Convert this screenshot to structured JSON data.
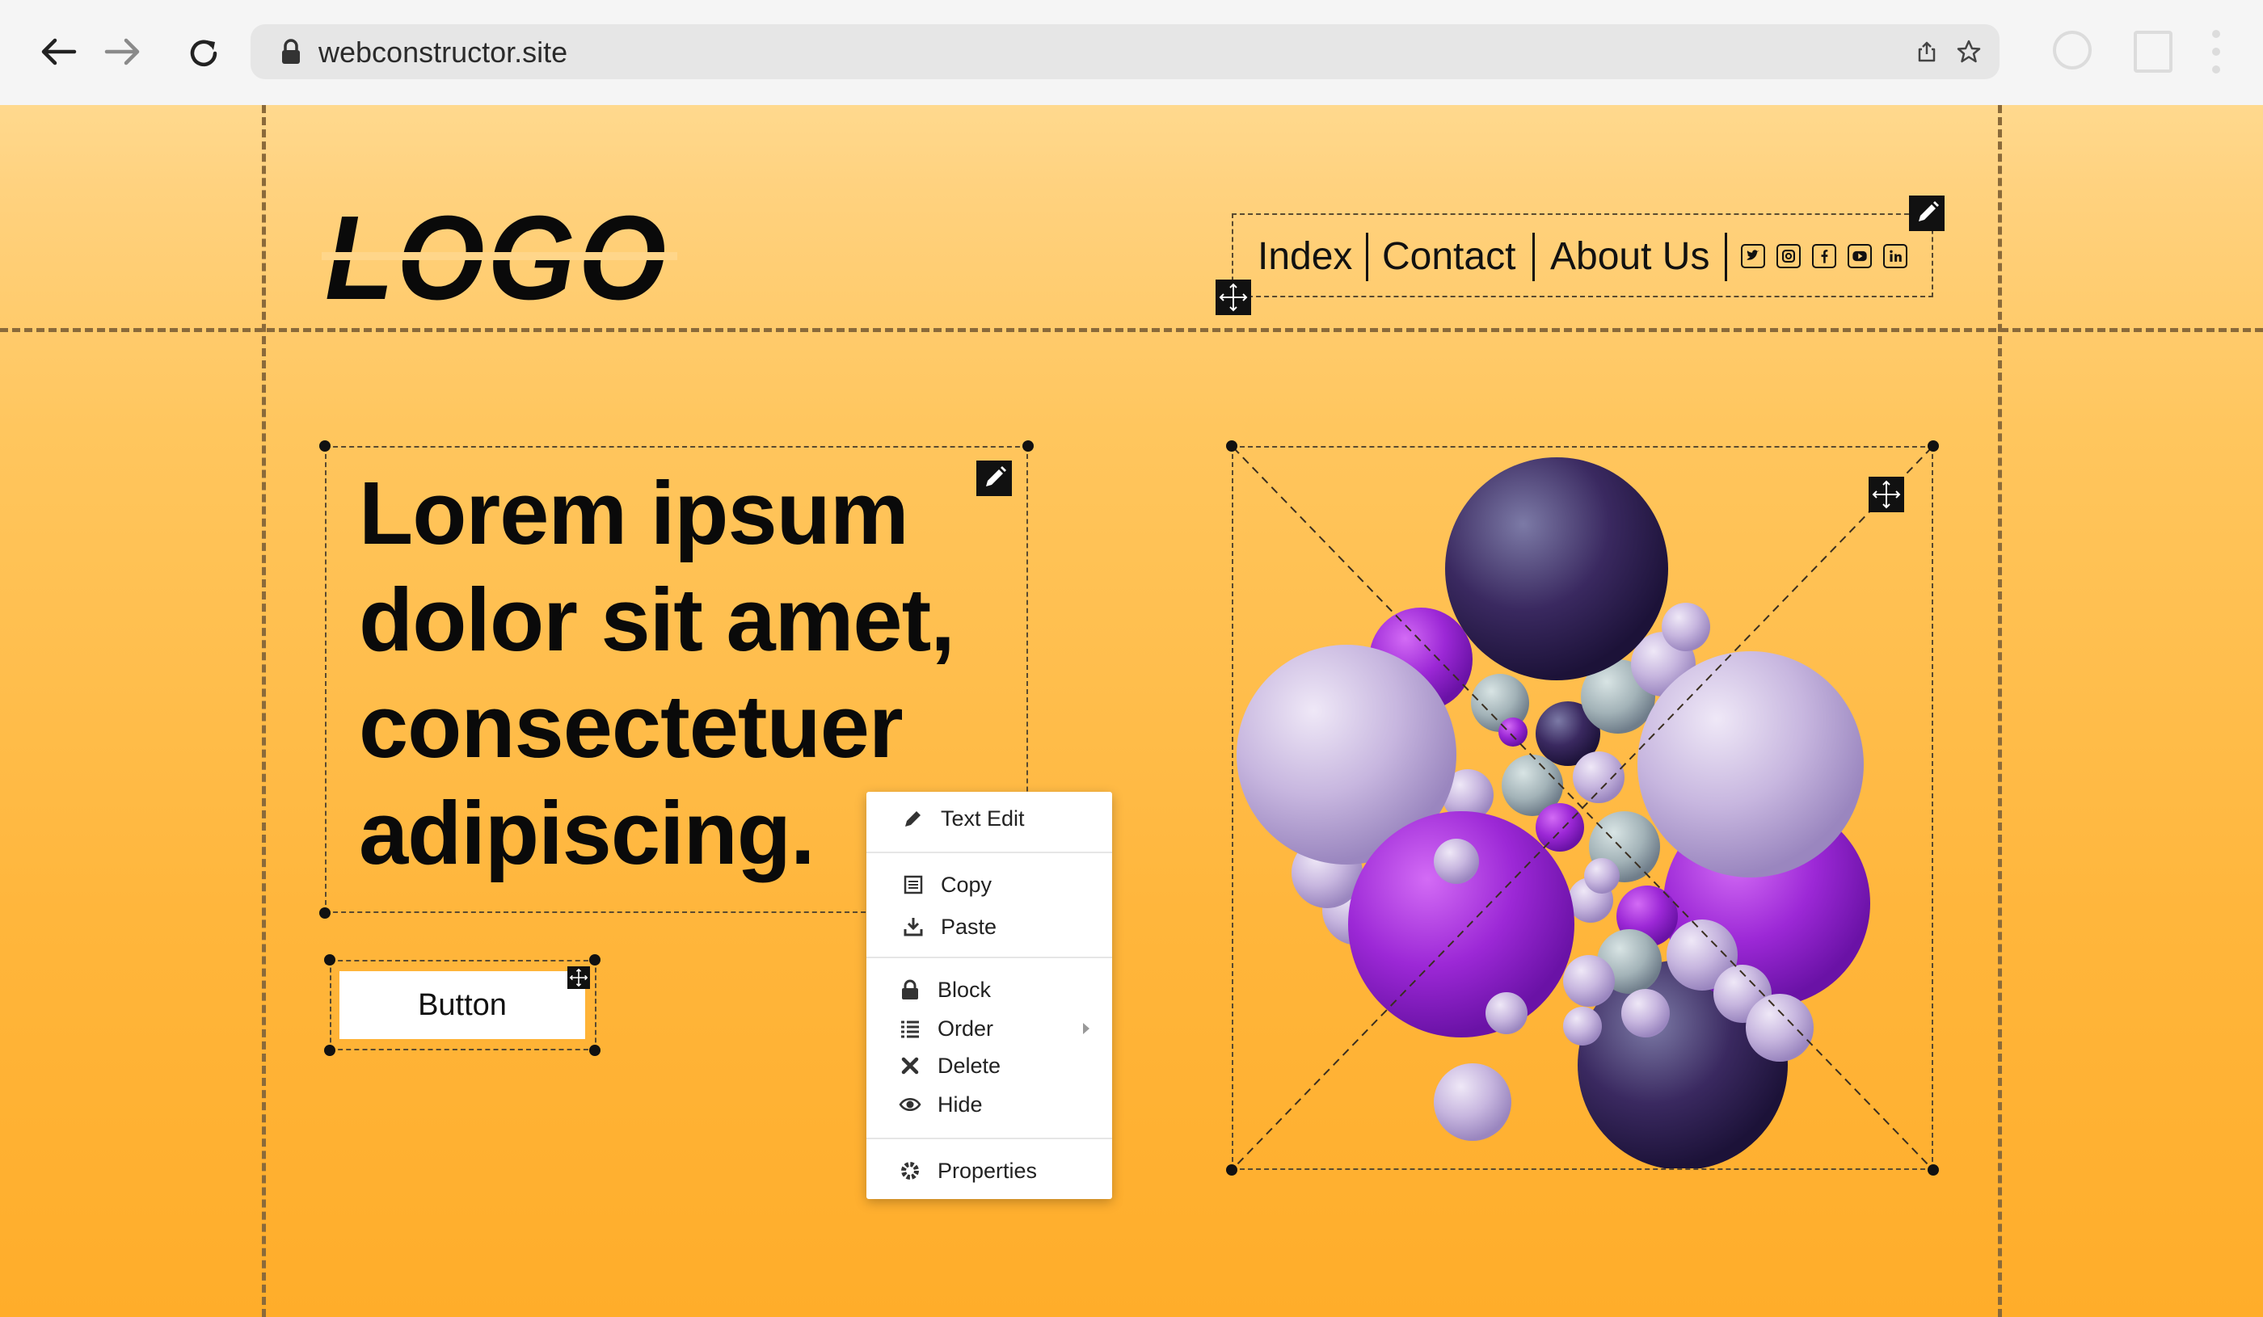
{
  "browser": {
    "url": "webconstructor.site",
    "icons": {
      "back": "arrow-left-icon",
      "forward": "arrow-right-icon",
      "reload": "reload-icon",
      "lock": "lock-icon",
      "share": "share-icon",
      "bookmark": "star-icon"
    }
  },
  "toolbar": {
    "tools": [
      "text-tool-icon",
      "image-tool-icon",
      "gallery-tool-icon",
      "video-tool-icon",
      "map-tool-icon",
      "shape-tool-icon",
      "share-tool-icon",
      "list-tool-icon",
      "sitemap-tool-icon",
      "translate-tool-icon",
      "frame-tool-icon",
      "cart-tool-icon",
      "form-tool-icon",
      "users-tool-icon",
      "settings-tool-icon"
    ]
  },
  "site": {
    "logo_text": "LOGO",
    "nav": [
      "Index",
      "Contact",
      "About Us"
    ],
    "social": [
      "twitter-icon",
      "instagram-icon",
      "facebook-icon",
      "youtube-icon",
      "linkedin-icon"
    ],
    "hero_lines": [
      "Lorem ipsum",
      "dolor sit amet,",
      "consectetuer",
      "adipiscing."
    ],
    "button_label": "Button"
  },
  "context_menu": {
    "groups": [
      [
        {
          "label": "Text Edit",
          "icon": "pencil-icon"
        }
      ],
      [
        {
          "label": "Copy",
          "icon": "copy-icon"
        },
        {
          "label": "Paste",
          "icon": "paste-icon"
        }
      ],
      [
        {
          "label": "Block",
          "icon": "lock-icon"
        },
        {
          "label": "Order",
          "icon": "list-icon",
          "submenu": true
        },
        {
          "label": "Delete",
          "icon": "x-icon"
        },
        {
          "label": "Hide",
          "icon": "eye-icon"
        }
      ],
      [
        {
          "label": "Properties",
          "icon": "gear-icon"
        }
      ]
    ]
  },
  "colors": {
    "canvas_top": "#ffd27f",
    "canvas_bottom": "#ffad2a",
    "ink": "#111111"
  }
}
